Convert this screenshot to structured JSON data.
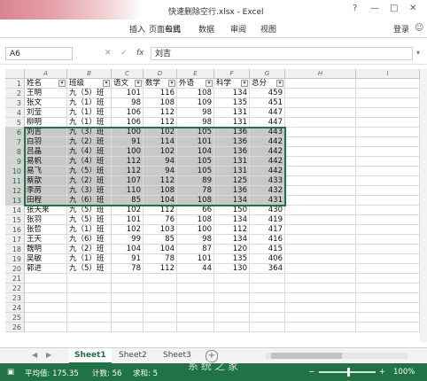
{
  "window": {
    "title": "快速删除空行.xlsx - Excel",
    "help": "?",
    "minimize": "—",
    "restore": "□",
    "close": "✕"
  },
  "ribbon": {
    "tabs": [
      "插入",
      "页面布局",
      "公式",
      "数据",
      "审阅",
      "视图"
    ],
    "login": "登录"
  },
  "formula_bar": {
    "name_box": "A6",
    "cancel": "✕",
    "enter": "✓",
    "fx": "fx",
    "value": "刘吉"
  },
  "columns": [
    "A",
    "B",
    "C",
    "D",
    "E",
    "F",
    "G",
    "H",
    "I"
  ],
  "headers": [
    "姓名",
    "班级",
    "语文",
    "数学",
    "外语",
    "科学",
    "总分"
  ],
  "rows": [
    [
      "王明",
      "九（5）班",
      "101",
      "116",
      "108",
      "134",
      "459"
    ],
    [
      "张文",
      "九（1）班",
      "98",
      "108",
      "109",
      "135",
      "451"
    ],
    [
      "刘莹",
      "九（1）班",
      "106",
      "112",
      "98",
      "131",
      "447"
    ],
    [
      "柳明",
      "九（1）班",
      "106",
      "112",
      "98",
      "131",
      "447"
    ],
    [
      "刘吉",
      "九（3）班",
      "100",
      "102",
      "105",
      "136",
      "443"
    ],
    [
      "白羽",
      "九（2）班",
      "91",
      "114",
      "101",
      "136",
      "442"
    ],
    [
      "吕晶",
      "九（4）班",
      "100",
      "102",
      "104",
      "136",
      "442"
    ],
    [
      "易帆",
      "九（4）班",
      "112",
      "94",
      "105",
      "131",
      "442"
    ],
    [
      "易飞",
      "九（5）班",
      "112",
      "94",
      "105",
      "131",
      "442"
    ],
    [
      "蔡歆",
      "九（2）班",
      "107",
      "112",
      "89",
      "125",
      "433"
    ],
    [
      "李苈",
      "九（3）班",
      "110",
      "108",
      "78",
      "136",
      "432"
    ],
    [
      "田程",
      "九（6）班",
      "85",
      "104",
      "108",
      "134",
      "431"
    ],
    [
      "张天来",
      "九（5）班",
      "102",
      "112",
      "66",
      "150",
      "430"
    ],
    [
      "张羽",
      "九（5）班",
      "101",
      "76",
      "108",
      "134",
      "419"
    ],
    [
      "张哲",
      "九（1）班",
      "102",
      "103",
      "100",
      "112",
      "417"
    ],
    [
      "王天",
      "九（6）班",
      "99",
      "85",
      "98",
      "134",
      "416"
    ],
    [
      "魏明",
      "九（2）班",
      "104",
      "104",
      "87",
      "120",
      "415"
    ],
    [
      "吴敏",
      "九（1）班",
      "91",
      "78",
      "101",
      "135",
      "406"
    ],
    [
      "郭进",
      "九（5）班",
      "78",
      "112",
      "44",
      "130",
      "364"
    ]
  ],
  "selected_rows": [
    6,
    7,
    8,
    9,
    10,
    11,
    12,
    13
  ],
  "sheets": [
    "Sheet1",
    "Sheet2",
    "Sheet3"
  ],
  "active_sheet": "Sheet1",
  "status": {
    "average": "平均值: 175.35",
    "count": "计数: 56",
    "sum": "求和: 5",
    "zoom": "100%",
    "zoom_minus": "−",
    "zoom_plus": "+"
  },
  "watermark": "系统之家",
  "accent_color": "#217346"
}
